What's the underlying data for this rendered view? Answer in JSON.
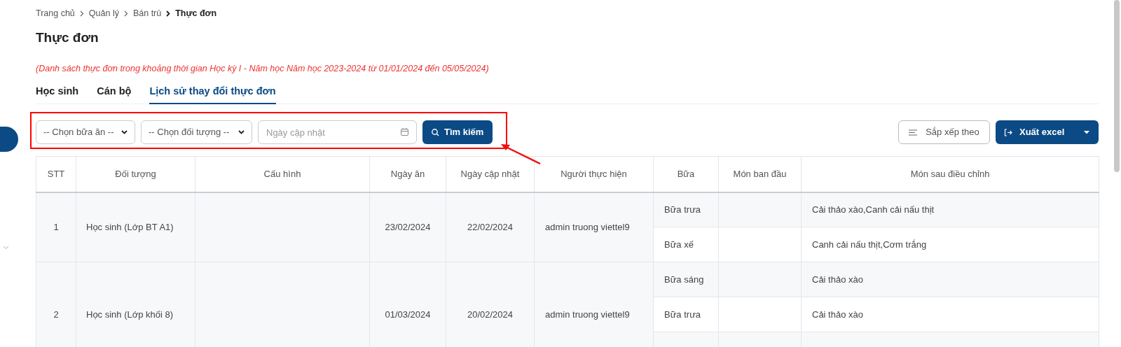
{
  "breadcrumb": [
    {
      "label": "Trang chủ",
      "current": false
    },
    {
      "label": "Quản lý",
      "current": false
    },
    {
      "label": "Bán trú",
      "current": false
    },
    {
      "label": "Thực đơn",
      "current": true
    }
  ],
  "title": "Thực đơn",
  "note": "(Danh sách thực đơn trong khoảng thời gian Học kỳ I - Năm học Năm học 2023-2024 từ 01/01/2024 đến 05/05/2024)",
  "tabs": [
    {
      "label": "Học sinh",
      "selected": false
    },
    {
      "label": "Cán bộ",
      "selected": false
    },
    {
      "label": "Lịch sử thay đổi thực đơn",
      "selected": true
    }
  ],
  "filters": {
    "meal_select": "-- Chọn bữa ăn --",
    "target_select": "-- Chọn đối tượng --",
    "date": {
      "placeholder": "Ngày cập nhật"
    },
    "search_button": "Tìm kiếm"
  },
  "sort_button": "Sắp xếp theo",
  "export_button": "Xuất excel",
  "table": {
    "columns": [
      "STT",
      "Đối tượng",
      "Cấu hình",
      "Ngày ăn",
      "Ngày cập nhật",
      "Người thực hiện",
      "Bữa",
      "Món ban đầu",
      "Món sau điều chỉnh"
    ],
    "rows": [
      {
        "stt": "1",
        "target": "Học sinh (Lớp BT A1)",
        "meal_date": "23/02/2024",
        "updated": "22/02/2024",
        "user": "admin truong viettel9",
        "meals": [
          {
            "meal": "Bữa trưa",
            "after": "Cải thảo xào,Canh cải nấu thịt"
          },
          {
            "meal": "Bữa xế",
            "after": "Canh cải nấu thịt,Cơm trắng"
          }
        ]
      },
      {
        "stt": "2",
        "target": "Học sinh (Lớp khối 8)",
        "meal_date": "01/03/2024",
        "updated": "20/02/2024",
        "user": "admin truong viettel9",
        "meals": [
          {
            "meal": "Bữa sáng",
            "after": "Cải thảo xào"
          },
          {
            "meal": "Bữa trưa",
            "after": "Cải thảo xào"
          }
        ]
      }
    ]
  }
}
